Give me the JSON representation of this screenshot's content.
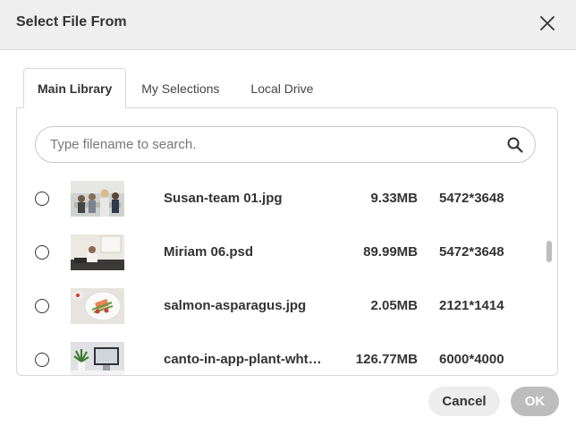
{
  "dialog": {
    "title": "Select File From",
    "close_icon": "close-icon"
  },
  "tabs": [
    {
      "label": "Main Library",
      "active": true
    },
    {
      "label": "My Selections",
      "active": false
    },
    {
      "label": "Local Drive",
      "active": false
    }
  ],
  "search": {
    "placeholder": "Type filename to search.",
    "value": "",
    "icon": "search-icon"
  },
  "files": [
    {
      "name": "Susan-team 01.jpg",
      "size": "9.33MB",
      "dimensions": "5472*3648",
      "selected": false
    },
    {
      "name": "Miriam 06.psd",
      "size": "89.99MB",
      "dimensions": "5472*3648",
      "selected": false
    },
    {
      "name": "salmon-asparagus.jpg",
      "size": "2.05MB",
      "dimensions": "2121*1414",
      "selected": false
    },
    {
      "name": "canto-in-app-plant-wht…",
      "size": "126.77MB",
      "dimensions": "6000*4000",
      "selected": false
    }
  ],
  "buttons": {
    "cancel_label": "Cancel",
    "ok_label": "OK"
  },
  "colors": {
    "header_bg": "#efefef",
    "ok_disabled": "#bdbdbd",
    "cancel_bg": "#ededed"
  }
}
